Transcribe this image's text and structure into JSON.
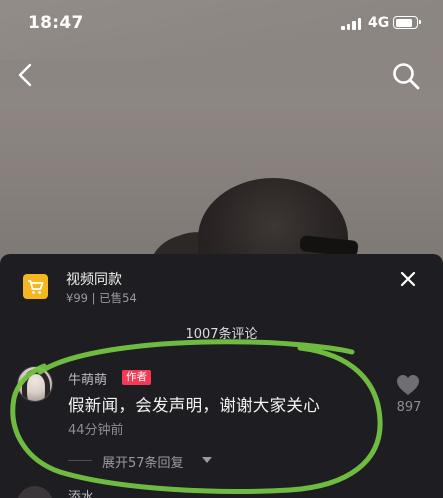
{
  "status_bar": {
    "time": "18:47",
    "network": "4G",
    "battery_level": 0.85
  },
  "product": {
    "title": "视频同款",
    "meta": "¥99 | 已售54"
  },
  "comments_header": "1007条评论",
  "comment": {
    "author": "牛萌萌",
    "badge": "作者",
    "text": "假新闻，会发声明，谢谢大家关心",
    "time": "44分钟前",
    "likes": "897",
    "expand_label": "展开57条回复"
  },
  "next_comment": {
    "author": "添水"
  },
  "colors": {
    "sheet_bg": "#1e1d21",
    "badge": "#f23a55",
    "cart": "#f5b622",
    "annotation": "#74c442"
  },
  "icons": [
    "back-icon",
    "search-icon",
    "cart-icon",
    "close-icon",
    "heart-icon",
    "caret-down-icon"
  ]
}
